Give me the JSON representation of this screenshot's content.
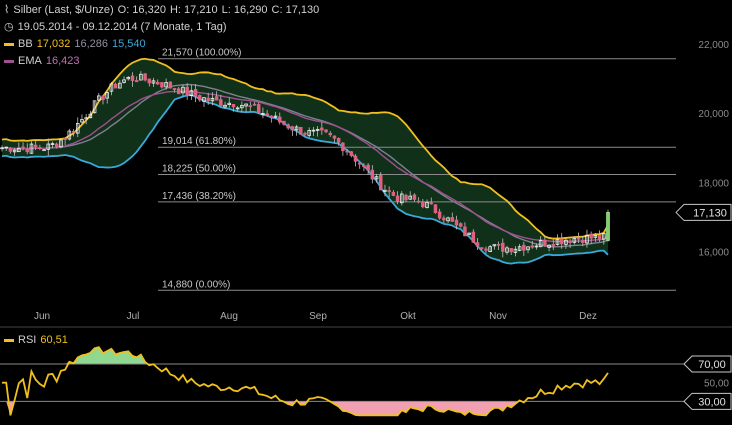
{
  "header": {
    "instrument": "Silber (Last, $/Unze)",
    "open": "O: 16,320",
    "high": "H: 17,210",
    "low": "L: 16,290",
    "close": "C: 17,130",
    "period": "19.05.2014 - 09.12.2014 (7 Monate, 1 Tag)",
    "bb_label": "BB",
    "bb_values": [
      "17,032",
      "16,286",
      "15,540"
    ],
    "ema_label": "EMA",
    "ema_value": "16,423",
    "rsi_label": "RSI",
    "rsi_value": "60,51"
  },
  "colors": {
    "background": "#000000",
    "bb_band": "#f0c020",
    "bb_lower": "#3aa8d8",
    "bb_mid": "#808090",
    "bb_fill": "#10301a",
    "ema": "#a05090",
    "up_candle": "#ffffff",
    "down_candle": "#e06080",
    "rsi_line": "#f0c020",
    "rsi_overbought_fill": "#90d890",
    "rsi_oversold_fill": "#f0a0b0",
    "grid": "#8a8a8a"
  },
  "chart_data": [
    {
      "type": "candlestick",
      "title": "Silber (Last, $/Unze)",
      "x_tick_labels": [
        "Jun",
        "Jul",
        "Aug",
        "Sep",
        "Okt",
        "Nov",
        "Dez"
      ],
      "y_tick_labels": [
        "16,000",
        "18,000",
        "20,000",
        "22,000"
      ],
      "y_ticks": [
        16,
        18,
        20,
        22
      ],
      "ylim": [
        14.6,
        22.4
      ],
      "current_price_label": "17,130",
      "current_price": 17.13,
      "fibonacci": [
        {
          "label": "21,570 (100.00%)",
          "value": 21.57
        },
        {
          "label": "19,014 (61.80%)",
          "value": 19.014
        },
        {
          "label": "18,225 (50.00%)",
          "value": 18.225
        },
        {
          "label": "17,436 (38.20%)",
          "value": 17.436
        },
        {
          "label": "14,880 (0.00%)",
          "value": 14.88
        }
      ],
      "ohlc_last": {
        "open": 16.32,
        "high": 17.21,
        "low": 16.29,
        "close": 17.13
      },
      "series_close_anchors": [
        {
          "month": "Jun",
          "value": 19.0
        },
        {
          "month": "Jul",
          "value": 21.0
        },
        {
          "month": "Aug",
          "value": 20.3
        },
        {
          "month": "Sep",
          "value": 19.4
        },
        {
          "month": "Okt",
          "value": 17.5
        },
        {
          "month": "Nov",
          "value": 16.1
        },
        {
          "month": "Dez",
          "value": 16.4
        }
      ]
    },
    {
      "type": "line",
      "title": "RSI",
      "current_value": 60.51,
      "y_ticks": [
        30,
        50,
        70
      ],
      "y_tick_labels": [
        "30,00",
        "50,00",
        "70,00"
      ],
      "ylim": [
        10,
        100
      ],
      "overbought": 70,
      "oversold": 30
    }
  ]
}
